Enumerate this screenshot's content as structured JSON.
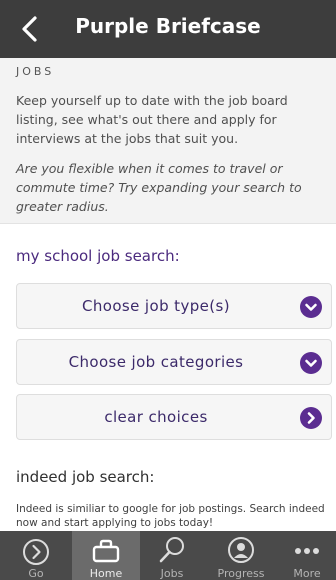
{
  "header": {
    "title": "Purple Briefcase",
    "back_icon": "chevron-left-icon"
  },
  "intro": {
    "section_label": "JOBS",
    "description": "Keep yourself up to date with the job board listing, see what's out there and apply for interviews at the jobs that suit you.",
    "tip": "Are you flexible when it comes to travel or commute time? Try expanding your search to greater radius."
  },
  "school_search": {
    "heading": "my school job search:",
    "buttons": [
      {
        "label": "Choose job type(s)",
        "icon": "chevron-down-circle-icon"
      },
      {
        "label": "Choose job categories",
        "icon": "chevron-down-circle-icon"
      },
      {
        "label": "clear choices",
        "icon": "chevron-right-circle-icon"
      }
    ]
  },
  "indeed_search": {
    "heading": "indeed job search:",
    "description": "Indeed is similiar to google for job postings. Search indeed now and start applying to jobs today!"
  },
  "tabbar": {
    "tabs": [
      {
        "label": "Go",
        "icon": "go-arrow-icon",
        "active": false
      },
      {
        "label": "Home",
        "icon": "briefcase-icon",
        "active": true
      },
      {
        "label": "Jobs",
        "icon": "search-icon",
        "active": false
      },
      {
        "label": "Progress",
        "icon": "progress-icon",
        "active": false
      },
      {
        "label": "More",
        "icon": "more-dots-icon",
        "active": false
      }
    ]
  },
  "colors": {
    "header_bg": "#3d3d3d",
    "accent_purple": "#5b2d91",
    "tabbar_bg": "#4a4a4a",
    "tab_active_bg": "#6b6b6b"
  }
}
